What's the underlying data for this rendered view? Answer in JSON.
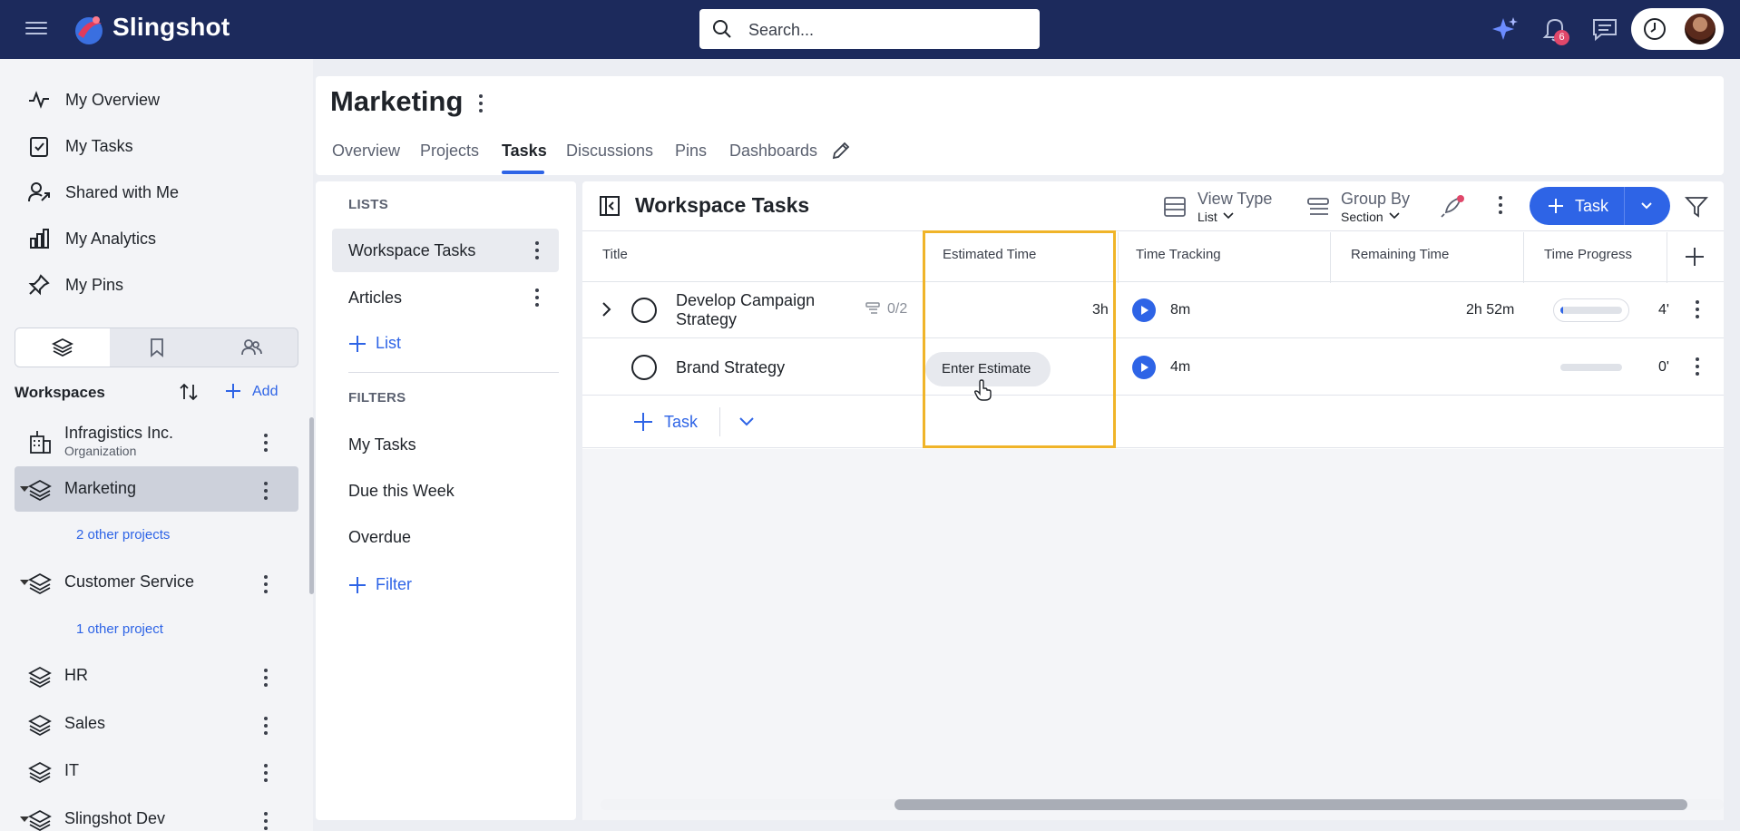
{
  "app": {
    "brand": "Slingshot",
    "search_placeholder": "Search...",
    "notification_count": "6"
  },
  "sidebar": {
    "nav": [
      {
        "label": "My Overview",
        "icon": "activity-icon"
      },
      {
        "label": "My Tasks",
        "icon": "clipboard-check-icon"
      },
      {
        "label": "Shared with Me",
        "icon": "shared-user-icon"
      },
      {
        "label": "My Analytics",
        "icon": "bar-chart-icon"
      },
      {
        "label": "My Pins",
        "icon": "pin-icon"
      }
    ],
    "workspaces_title": "Workspaces",
    "add_label": "Add",
    "workspaces": [
      {
        "name": "Infragistics Inc.",
        "sub": "Organization"
      },
      {
        "name": "Marketing",
        "more": "2 other projects"
      },
      {
        "name": "Customer Service",
        "more": "1 other project"
      },
      {
        "name": "HR"
      },
      {
        "name": "Sales"
      },
      {
        "name": "IT"
      },
      {
        "name": "Slingshot Dev"
      }
    ]
  },
  "page": {
    "title": "Marketing",
    "tabs": [
      "Overview",
      "Projects",
      "Tasks",
      "Discussions",
      "Pins",
      "Dashboards"
    ],
    "active_tab": "Tasks"
  },
  "lists_panel": {
    "lists_label": "LISTS",
    "lists": [
      "Workspace Tasks",
      "Articles"
    ],
    "add_list": "List",
    "filters_label": "FILTERS",
    "filters": [
      "My Tasks",
      "Due this Week",
      "Overdue"
    ],
    "add_filter": "Filter"
  },
  "grid": {
    "title": "Workspace Tasks",
    "view_type_label": "View Type",
    "view_type_value": "List",
    "group_by_label": "Group By",
    "group_by_value": "Section",
    "task_button": "Task",
    "columns": [
      "Title",
      "Estimated Time",
      "Time Tracking",
      "Remaining Time",
      "Time Progress"
    ],
    "rows": [
      {
        "title_line1": "Develop Campaign",
        "title_line2": "Strategy",
        "subtasks": "0/2",
        "estimated": "3h",
        "tracked": "8m",
        "remaining": "2h 52m",
        "progress_pct": 4,
        "progress_text": "4'"
      },
      {
        "title_line1": "Brand Strategy",
        "estimated_prompt": "Enter Estimate",
        "tracked": "4m",
        "remaining": "",
        "progress_pct": 0,
        "progress_text": "0'"
      }
    ],
    "add_task": "Task"
  },
  "colors": {
    "topbar": "#1c2a5c",
    "accent": "#2e64e6",
    "highlight": "#f0b429"
  }
}
